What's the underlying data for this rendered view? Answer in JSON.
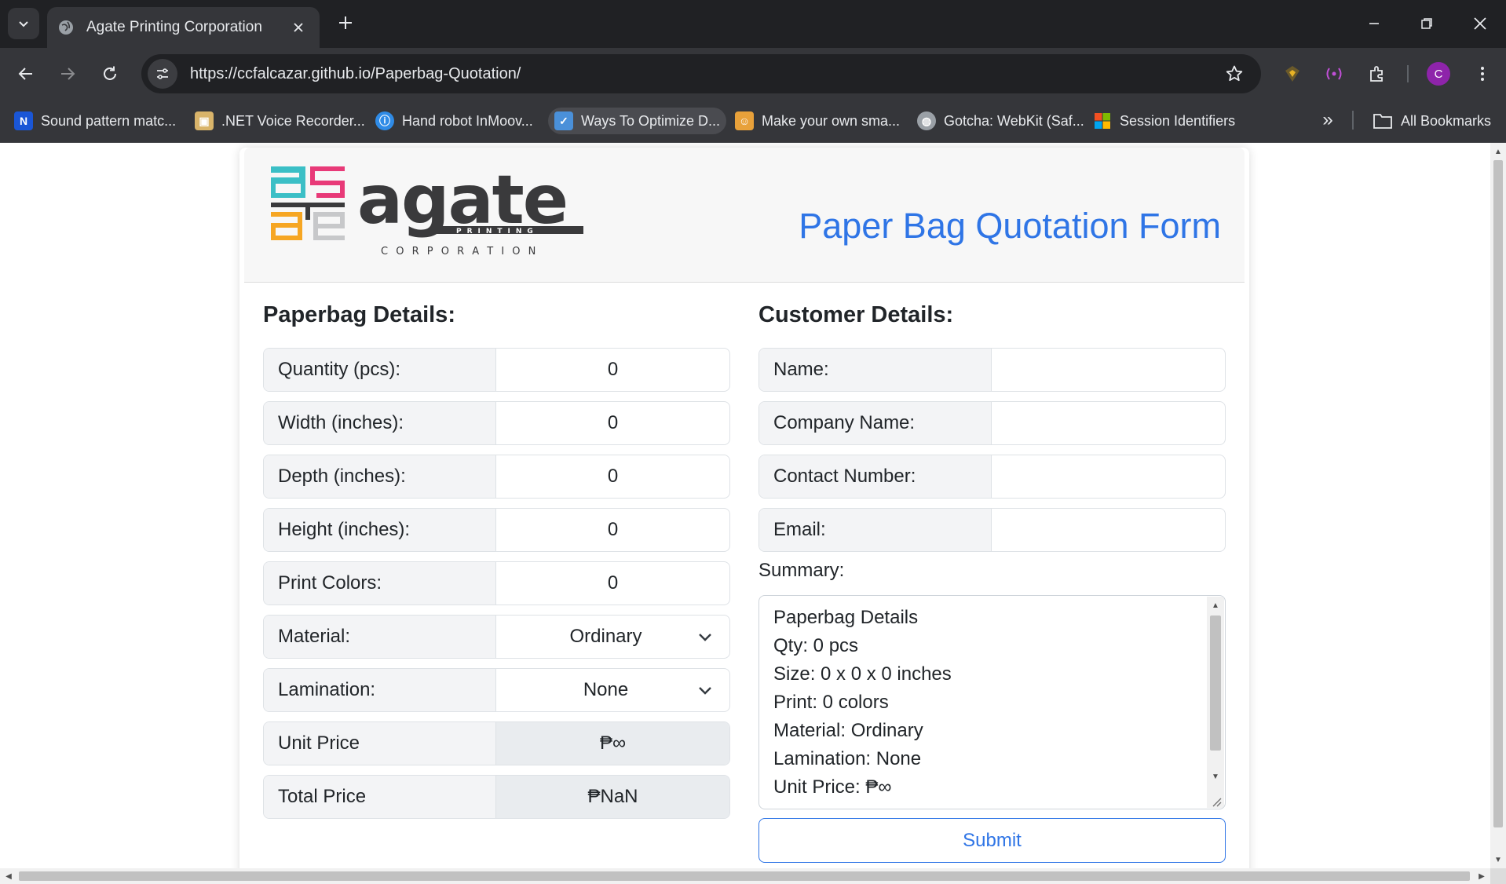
{
  "browser": {
    "tab_title": "Agate Printing Corporation",
    "url": "https://ccfalcazar.github.io/Paperbag-Quotation/",
    "profile_initial": "C",
    "bookmarks": [
      {
        "label": "Sound pattern matc...",
        "icon": "n-logo-icon"
      },
      {
        "label": ".NET Voice Recorder...",
        "icon": "recorder-icon"
      },
      {
        "label": "Hand robot InMoov...",
        "icon": "robot-icon"
      },
      {
        "label": "Ways To Optimize D...",
        "icon": "optimize-icon"
      },
      {
        "label": "Make your own sma...",
        "icon": "maker-icon"
      },
      {
        "label": "Gotcha: WebKit (Saf...",
        "icon": "globe-icon"
      },
      {
        "label": "Session Identifiers",
        "icon": "microsoft-icon"
      }
    ],
    "all_bookmarks_label": "All Bookmarks"
  },
  "header": {
    "form_title": "Paper Bag Quotation Form",
    "logo_text": "agate",
    "logo_sub1": "PRINTING",
    "logo_sub2": "C O R P O R A T I O N"
  },
  "paperbag": {
    "title": "Paperbag Details:",
    "fields": [
      {
        "label": "Quantity (pcs):",
        "value": "0"
      },
      {
        "label": "Width (inches):",
        "value": "0"
      },
      {
        "label": "Depth (inches):",
        "value": "0"
      },
      {
        "label": "Height (inches):",
        "value": "0"
      },
      {
        "label": "Print Colors:",
        "value": "0"
      }
    ],
    "material": {
      "label": "Material:",
      "value": "Ordinary"
    },
    "lamination": {
      "label": "Lamination:",
      "value": "None"
    },
    "unit_price": {
      "label": "Unit Price",
      "value": "₱∞"
    },
    "total_price": {
      "label": "Total Price",
      "value": "₱NaN"
    }
  },
  "customer": {
    "title": "Customer Details:",
    "fields": [
      {
        "label": "Name:",
        "value": ""
      },
      {
        "label": "Company Name:",
        "value": ""
      },
      {
        "label": "Contact Number:",
        "value": ""
      },
      {
        "label": "Email:",
        "value": ""
      }
    ],
    "summary_label": "Summary:",
    "summary_lines": [
      "Paperbag Details",
      "Qty: 0 pcs",
      "Size: 0 x 0 x 0 inches",
      "Print: 0 colors",
      "Material: Ordinary",
      "Lamination: None",
      "Unit Price: ₱∞"
    ],
    "submit_label": "Submit"
  },
  "colors": {
    "accent": "#2f75e6",
    "logo_cyan": "#3bbfc6",
    "logo_magenta": "#e83a78",
    "logo_orange": "#f6a623",
    "logo_gray": "#c7c8ca",
    "logo_dark": "#3a3a3c"
  }
}
